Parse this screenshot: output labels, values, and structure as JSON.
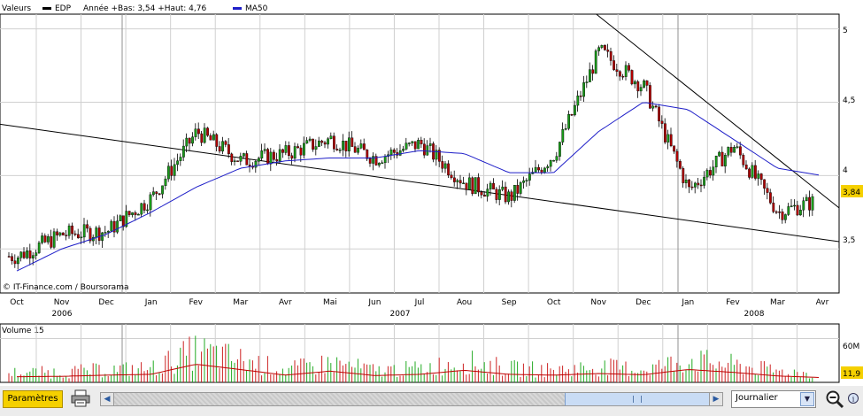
{
  "header": {
    "values_label": "Valeurs",
    "ticker": "EDP",
    "range_text": "Année +Bas: 3,54 +Haut: 4,76",
    "ma_label": "MA50"
  },
  "price_axis": {
    "ticks": [
      "5",
      "4,5",
      "4",
      "3,5"
    ],
    "last_value": "3,84"
  },
  "source": "© IT-Finance.com / Boursorama",
  "months": [
    "Oct",
    "Nov",
    "Dec",
    "Jan",
    "Fev",
    "Mar",
    "Avr",
    "Mai",
    "Jun",
    "Jul",
    "Aou",
    "Sep",
    "Oct",
    "Nov",
    "Dec",
    "Jan",
    "Fev",
    "Mar",
    "Avr"
  ],
  "years": [
    "2006",
    "2007",
    "2008"
  ],
  "volume": {
    "label": "Volume 15",
    "tick_top": "60M",
    "last_value": "11,9"
  },
  "toolbar": {
    "params_label": "Paramètres",
    "period_label": "Journalier",
    "period_arrow": "▼",
    "scroll_left": "◀",
    "scroll_right": "▶"
  },
  "colors": {
    "up": "#1a9b1a",
    "down": "#b00000",
    "ma": "#1e1ec8",
    "trend": "#000000",
    "volume_up": "#22aa22",
    "volume_down": "#cc2222",
    "volume_ma": "#c00000",
    "last_badge": "#f5d000"
  },
  "chart_data": [
    {
      "type": "line",
      "title": "EDP",
      "subtitle": "Année +Bas: 3,54 +Haut: 4,76",
      "ylim": [
        3.2,
        5.1
      ],
      "y_ticks": [
        3.5,
        4,
        4.5,
        5
      ],
      "x": [
        "2006-10-01",
        "2006-11-01",
        "2006-12-01",
        "2007-01-01",
        "2007-02-01",
        "2007-03-01",
        "2007-04-01",
        "2007-05-01",
        "2007-06-01",
        "2007-07-01",
        "2007-08-01",
        "2007-09-01",
        "2007-10-01",
        "2007-11-01",
        "2007-12-01",
        "2008-01-01",
        "2008-02-01",
        "2008-03-01",
        "2008-04-01"
      ],
      "series": [
        {
          "name": "EDP",
          "values": [
            3.45,
            3.6,
            3.62,
            3.85,
            4.3,
            4.1,
            4.15,
            4.25,
            4.12,
            4.22,
            3.95,
            3.85,
            4.15,
            4.85,
            4.6,
            3.9,
            4.2,
            3.75,
            3.84
          ]
        },
        {
          "name": "MA50",
          "values": [
            3.35,
            3.5,
            3.6,
            3.75,
            3.92,
            4.05,
            4.1,
            4.12,
            4.12,
            4.17,
            4.15,
            4.02,
            4.02,
            4.3,
            4.5,
            4.45,
            4.25,
            4.05,
            4.0
          ]
        }
      ],
      "last_value": 3.84
    },
    {
      "type": "bar",
      "title": "Volume 15",
      "ylim": [
        0,
        80
      ],
      "y_ticks": [
        60
      ],
      "unit": "M",
      "x": [
        "2006-10-01",
        "2006-11-01",
        "2006-12-01",
        "2007-01-01",
        "2007-02-01",
        "2007-03-01",
        "2007-04-01",
        "2007-05-01",
        "2007-06-01",
        "2007-07-01",
        "2007-08-01",
        "2007-09-01",
        "2007-10-01",
        "2007-11-01",
        "2007-12-01",
        "2008-01-01",
        "2008-02-01",
        "2008-03-01",
        "2008-04-01"
      ],
      "values": [
        14,
        15,
        18,
        20,
        45,
        32,
        18,
        28,
        17,
        20,
        30,
        20,
        18,
        22,
        19,
        32,
        25,
        16,
        11.9
      ],
      "last_value": 11.9
    }
  ]
}
